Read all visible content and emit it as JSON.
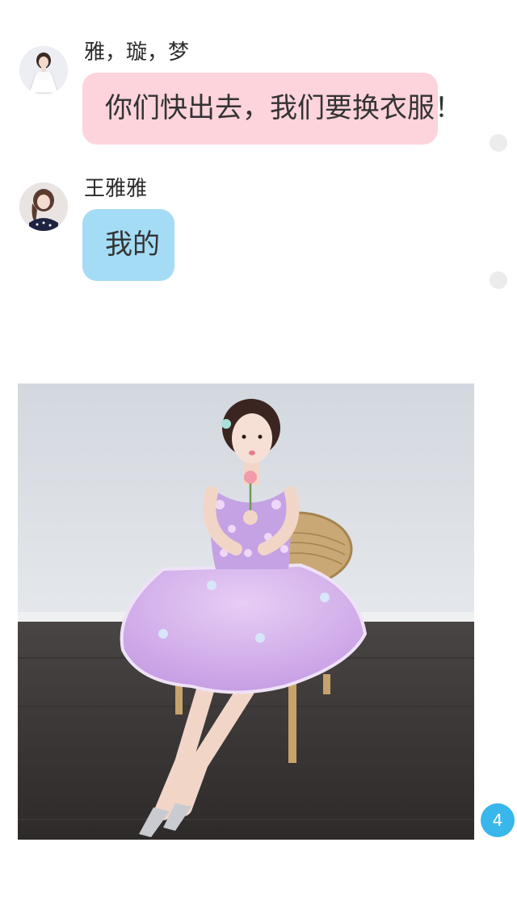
{
  "messages": [
    {
      "sender": "雅，璇，梦",
      "text": "你们快出去，我们要换衣服！",
      "bubble_color": "#fdd3dc",
      "avatar_icon": "girl-white-dress-avatar"
    },
    {
      "sender": "王雅雅",
      "text": "我的",
      "bubble_color": "#a4dcf6",
      "avatar_icon": "girl-dark-hair-avatar"
    }
  ],
  "photo": {
    "subject": "girl-lavender-dress-photo"
  },
  "page_badge": "4",
  "colors": {
    "badge": "#39b6ea",
    "pink_bubble": "#fdd3dc",
    "blue_bubble": "#a4dcf6"
  }
}
